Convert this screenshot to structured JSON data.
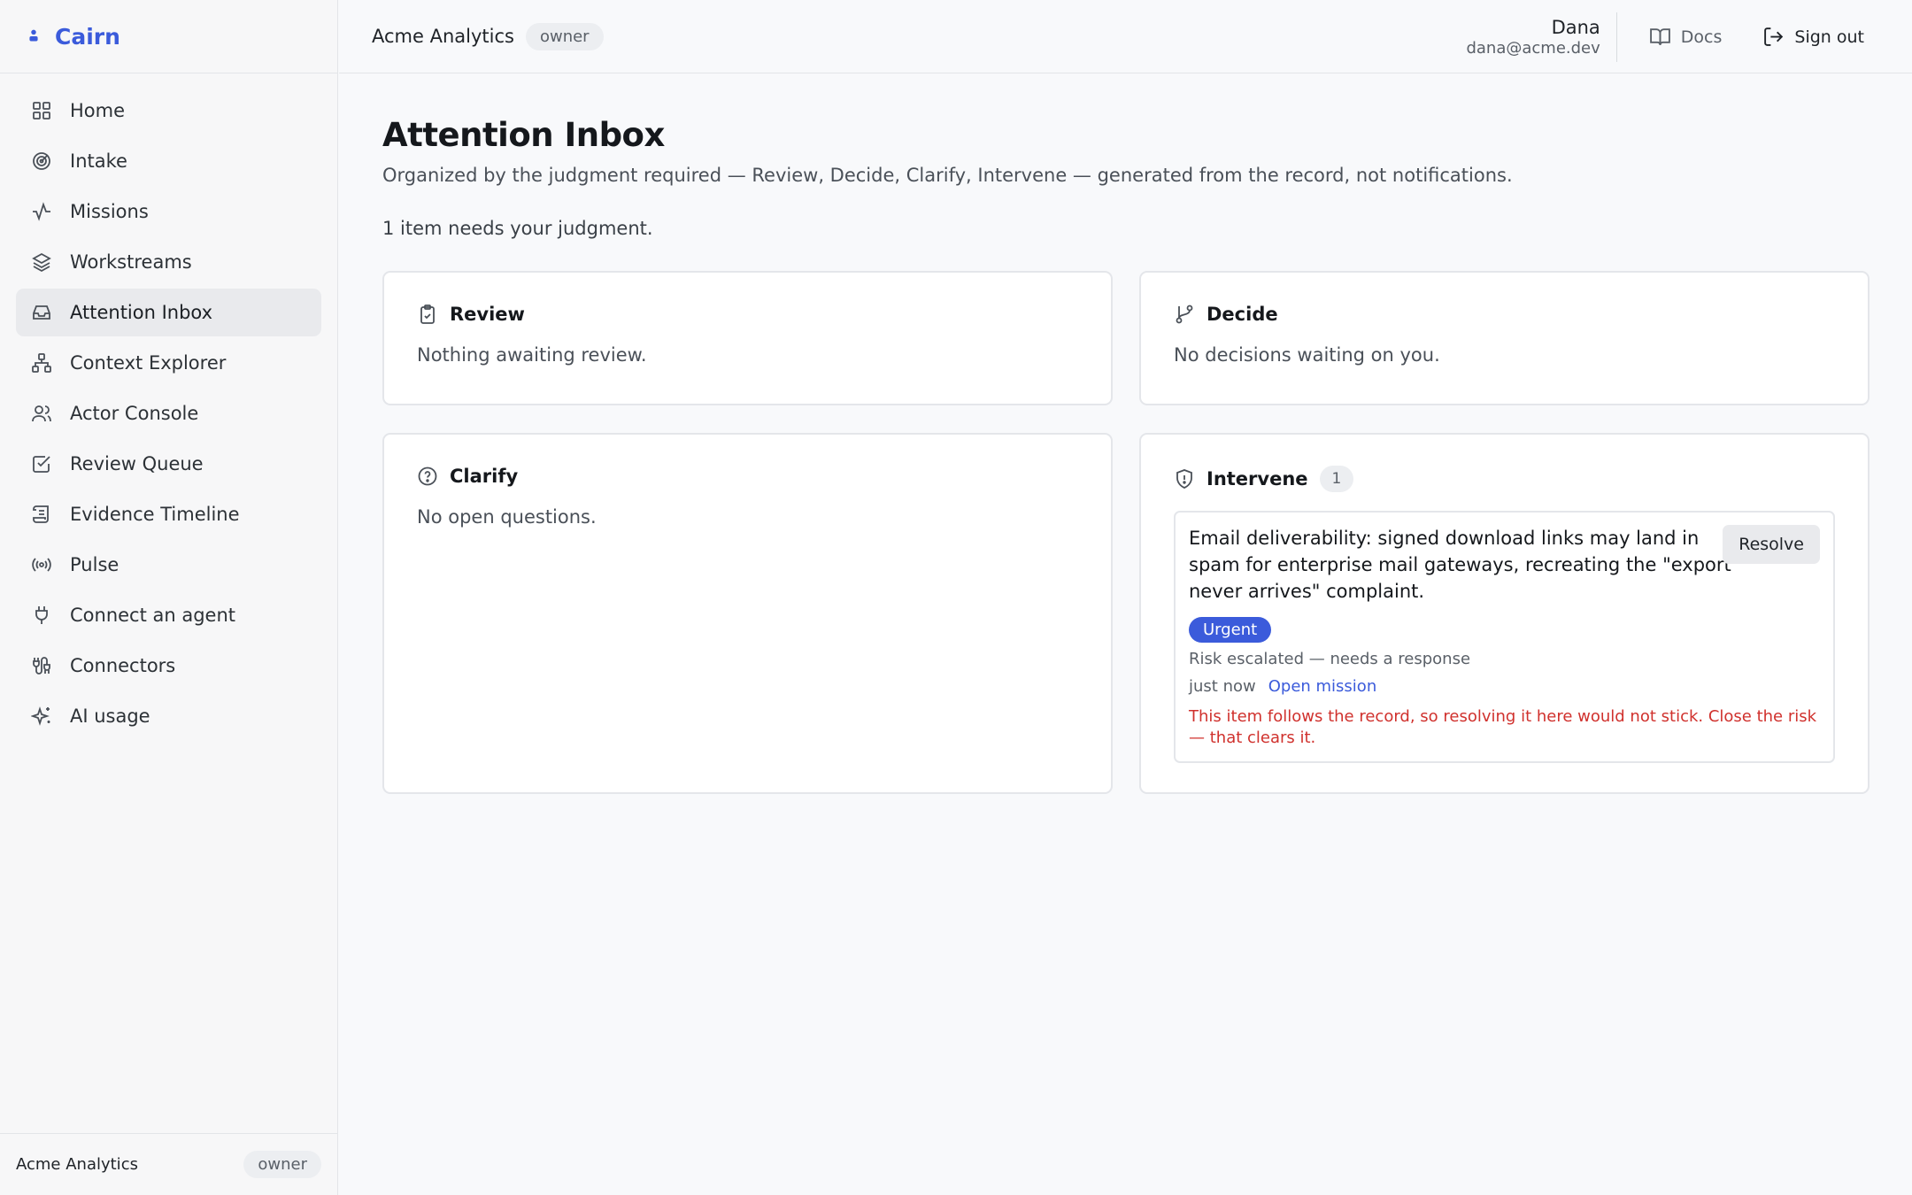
{
  "brand": {
    "name": "Cairn",
    "icon": "person-icon"
  },
  "sidebar": {
    "items": [
      {
        "label": "Home",
        "icon": "grid-icon",
        "active": false
      },
      {
        "label": "Intake",
        "icon": "target-icon",
        "active": false
      },
      {
        "label": "Missions",
        "icon": "activity-icon",
        "active": false
      },
      {
        "label": "Workstreams",
        "icon": "layers-icon",
        "active": false
      },
      {
        "label": "Attention Inbox",
        "icon": "inbox-icon",
        "active": true
      },
      {
        "label": "Context Explorer",
        "icon": "network-icon",
        "active": false
      },
      {
        "label": "Actor Console",
        "icon": "users-icon",
        "active": false
      },
      {
        "label": "Review Queue",
        "icon": "check-square-icon",
        "active": false
      },
      {
        "label": "Evidence Timeline",
        "icon": "scroll-icon",
        "active": false
      },
      {
        "label": "Pulse",
        "icon": "radio-icon",
        "active": false
      },
      {
        "label": "Connect an agent",
        "icon": "plug-icon",
        "active": false
      },
      {
        "label": "Connectors",
        "icon": "cable-icon",
        "active": false
      },
      {
        "label": "AI usage",
        "icon": "sparkles-icon",
        "active": false
      }
    ],
    "footer": {
      "org": "Acme Analytics",
      "role": "owner"
    }
  },
  "topbar": {
    "org": "Acme Analytics",
    "role": "owner",
    "user_name": "Dana",
    "user_email": "dana@acme.dev",
    "docs_label": "Docs",
    "signout_label": "Sign out"
  },
  "page": {
    "title": "Attention Inbox",
    "subtitle": "Organized by the judgment required — Review, Decide, Clarify, Intervene — generated from the record, not notifications.",
    "count_line": "1 item needs your judgment."
  },
  "cards": {
    "review": {
      "title": "Review",
      "empty": "Nothing awaiting review.",
      "icon": "clipboard-check-icon"
    },
    "decide": {
      "title": "Decide",
      "empty": "No decisions waiting on you.",
      "icon": "git-branch-icon"
    },
    "clarify": {
      "title": "Clarify",
      "empty": "No open questions.",
      "icon": "help-circle-icon"
    },
    "intervene": {
      "title": "Intervene",
      "count": "1",
      "icon": "shield-alert-icon",
      "item": {
        "text": "Email deliverability: signed download links may land in spam for enterprise mail gateways, recreating the \"export never arrives\" complaint.",
        "resolve_label": "Resolve",
        "badge": "Urgent",
        "meta": "Risk escalated — needs a response",
        "time": "just now",
        "link_label": "Open mission",
        "warning": "This item follows the record, so resolving it here would not stick. Close the risk — that clears it."
      }
    }
  },
  "colors": {
    "accent": "#3b5bdb",
    "warning": "#d0312d",
    "active_nav": "#e9eaed"
  }
}
